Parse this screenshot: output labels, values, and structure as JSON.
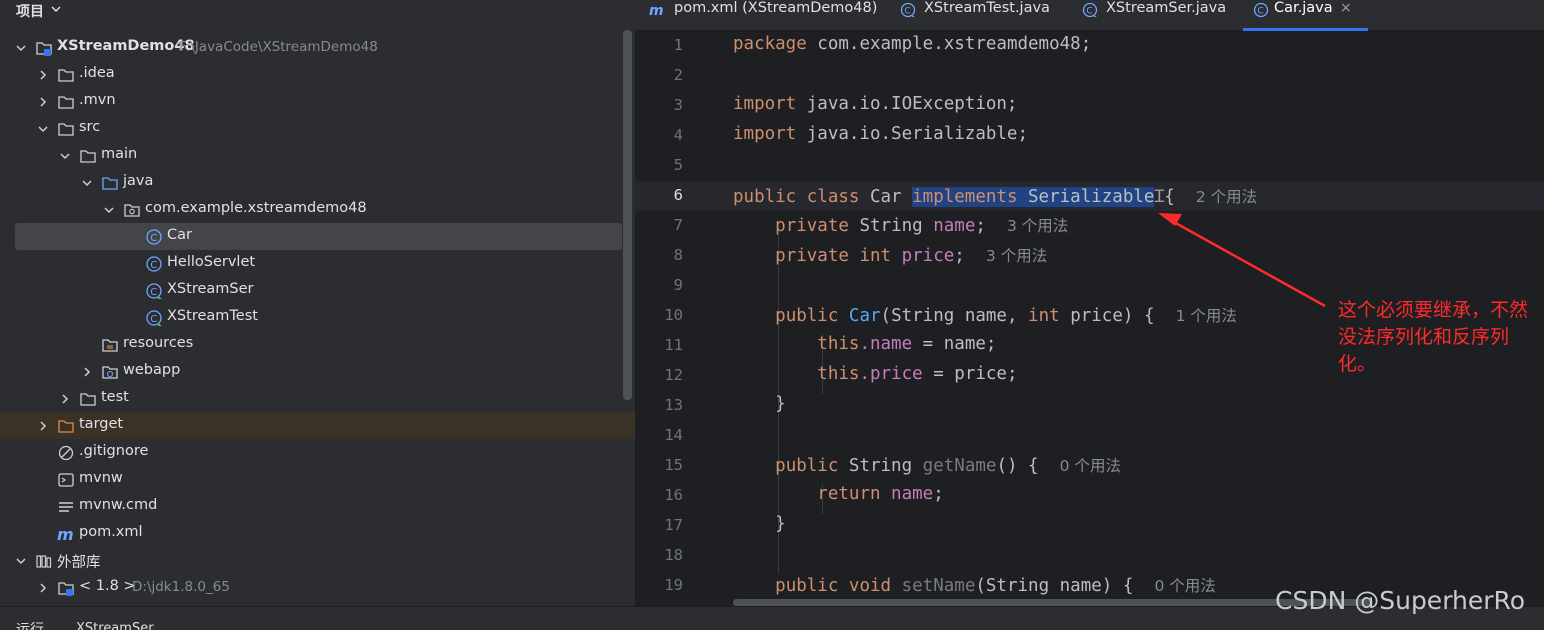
{
  "project_panel": {
    "title": "项目",
    "tree": [
      {
        "label": "XStreamDemo48",
        "path": "F:\\JavaCode\\XStreamDemo48",
        "icon": "module-folder-icon",
        "expanded": true
      },
      {
        "label": ".idea",
        "icon": "folder-icon"
      },
      {
        "label": ".mvn",
        "icon": "folder-icon"
      },
      {
        "label": "src",
        "icon": "folder-icon",
        "expanded": true
      },
      {
        "label": "main",
        "icon": "folder-icon",
        "expanded": true
      },
      {
        "label": "java",
        "icon": "source-folder-icon",
        "expanded": true
      },
      {
        "label": "com.example.xstreamdemo48",
        "icon": "package-icon",
        "expanded": true
      },
      {
        "label": "Car",
        "icon": "class-icon"
      },
      {
        "label": "HelloServlet",
        "icon": "class-icon"
      },
      {
        "label": "XStreamSer",
        "icon": "class-main-icon"
      },
      {
        "label": "XStreamTest",
        "icon": "class-main-icon"
      },
      {
        "label": "resources",
        "icon": "resources-folder-icon"
      },
      {
        "label": "webapp",
        "icon": "web-folder-icon"
      },
      {
        "label": "test",
        "icon": "folder-icon"
      },
      {
        "label": "target",
        "icon": "excluded-folder-icon"
      },
      {
        "label": ".gitignore",
        "icon": "ignore-file-icon"
      },
      {
        "label": "mvnw",
        "icon": "shell-file-icon"
      },
      {
        "label": "mvnw.cmd",
        "icon": "text-file-icon"
      },
      {
        "label": "pom.xml",
        "icon": "maven-icon"
      },
      {
        "label": "外部库",
        "icon": "library-icon",
        "expanded": true
      },
      {
        "label": "< 1.8 >",
        "path": "D:\\jdk1.8.0_65",
        "icon": "jdk-folder-icon"
      }
    ]
  },
  "tabs": [
    {
      "label": "pom.xml (XStreamDemo48)",
      "icon": "maven-icon"
    },
    {
      "label": "XStreamTest.java",
      "icon": "class-main-icon"
    },
    {
      "label": "XStreamSer.java",
      "icon": "class-main-icon"
    },
    {
      "label": "Car.java",
      "icon": "class-icon",
      "active": true
    }
  ],
  "tab_close": "×",
  "editor": {
    "line_numbers": [
      "1",
      "2",
      "3",
      "4",
      "5",
      "6",
      "7",
      "8",
      "9",
      "10",
      "11",
      "12",
      "13",
      "14",
      "15",
      "16",
      "17",
      "18",
      "19"
    ],
    "current_line": "6",
    "code": {
      "l1": {
        "kw": "package",
        "rest": " com.example.xstreamdemo48;"
      },
      "l3": {
        "kw": "import",
        "rest": " java.io.IOException;"
      },
      "l4": {
        "kw": "import",
        "rest": " java.io.Serializable;"
      },
      "l6": {
        "kw1": "public",
        "kw2": " class",
        "name": " Car ",
        "sel": "implements Serializable",
        "rest": "{",
        "hint": "2 个用法"
      },
      "l7": {
        "kw": "private",
        "type": " String ",
        "field": "name",
        "rest": ";",
        "hint": "3 个用法"
      },
      "l8": {
        "kw": "private",
        "type": " ",
        "kw2": "int",
        "field": " price",
        "rest": ";",
        "hint": "3 个用法"
      },
      "l10": {
        "kw": "public",
        "name": "Car",
        "p1": "(String name, ",
        "kw2": "int",
        "p2": " price) {",
        "hint": "1 个用法"
      },
      "l11": {
        "kw": "this",
        "field": ".name",
        "rest": " = name;"
      },
      "l12": {
        "kw": "this",
        "field": ".price",
        "rest": " = price;"
      },
      "l13": "}",
      "l15": {
        "kw": "public",
        "type": " String ",
        "name": "getName",
        "rest": "() {",
        "hint": "0 个用法"
      },
      "l16": {
        "kw": "return",
        "field": " name",
        "rest": ";"
      },
      "l17": "}",
      "l19": {
        "kw": "public",
        "kw2": " void",
        "name": " setName",
        "rest": "(String name) {",
        "hint": "0 个用法"
      }
    }
  },
  "annotation": {
    "text": "这个必须要继承，不然没法序列化和反序列化。",
    "color": "#ff2a2a"
  },
  "bottom_bar": {
    "run_label": "运行",
    "run_tab": "XStreamSer"
  },
  "watermark": "CSDN @SuperherRo"
}
